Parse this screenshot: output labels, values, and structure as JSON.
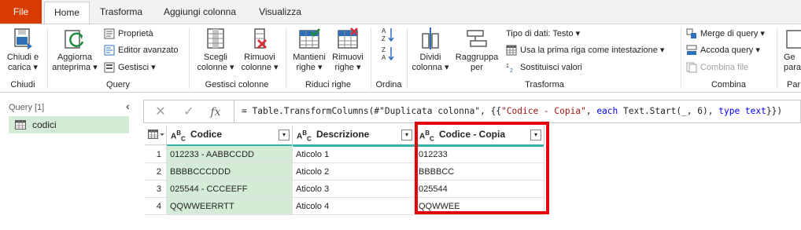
{
  "tabs": [
    "File",
    "Home",
    "Trasforma",
    "Aggiungi colonna",
    "Visualizza"
  ],
  "ribbon": {
    "chiudi": {
      "btn": [
        "Chiudi e",
        "carica ▾"
      ],
      "group": "Chiudi"
    },
    "query": {
      "aggiorna": [
        "Aggiorna",
        "anteprima ▾"
      ],
      "proprieta": "Proprietà",
      "editor": "Editor avanzato",
      "gestisci": "Gestisci ▾",
      "group": "Query"
    },
    "gestisci_colonne": {
      "scegli": [
        "Scegli",
        "colonne ▾"
      ],
      "rimuovi": [
        "Rimuovi",
        "colonne ▾"
      ],
      "group": "Gestisci colonne"
    },
    "riduci_righe": {
      "mantieni": [
        "Mantieni",
        "righe ▾"
      ],
      "rimuovi": [
        "Rimuovi",
        "righe ▾"
      ],
      "group": "Riduci righe"
    },
    "ordina": {
      "group": "Ordina"
    },
    "trasforma": {
      "dividi": [
        "Dividi",
        "colonna ▾"
      ],
      "raggruppa": [
        "Raggruppa",
        "per"
      ],
      "tipo": "Tipo di dati: Testo ▾",
      "prima_riga": "Usa la prima riga come intestazione ▾",
      "sostituisci": "Sostituisci valori",
      "group": "Trasforma"
    },
    "combina": {
      "merge": "Merge di query ▾",
      "accoda": "Accoda query ▾",
      "combina_file": "Combina file",
      "group": "Combina"
    },
    "param": {
      "btn": [
        "Ge",
        "para"
      ],
      "group": "Par"
    }
  },
  "query_pane": {
    "header": "Query [1]",
    "items": [
      "codici"
    ]
  },
  "formula": {
    "p1": "= Table.TransformColumns(#\"Duplicata colonna\", {{",
    "p2": "\"Codice - Copia\"",
    "p3": ", ",
    "p4": "each",
    "p5": " Text.Start(_, 6), ",
    "p6": "type text",
    "p7": "}})"
  },
  "table": {
    "type_label": "A",
    "columns": [
      "Codice",
      "Descrizione",
      "Codice - Copia"
    ],
    "rows": [
      [
        "1",
        "012233 - AABBCCDD",
        "Aticolo 1",
        "012233"
      ],
      [
        "2",
        "BBBBCCCDDD",
        "Aticolo 2",
        "BBBBCC"
      ],
      [
        "3",
        "025544 - CCCEEFF",
        "Aticolo 3",
        "025544"
      ],
      [
        "4",
        "QQWWEERRTT",
        "Aticolo 4",
        "QQWWEE"
      ]
    ]
  },
  "colors": {
    "file_tab": "#d83b01",
    "selected_column": "#d4ecd6",
    "quality_bar": "#36b2a7",
    "highlight_box": "#e8000b"
  }
}
